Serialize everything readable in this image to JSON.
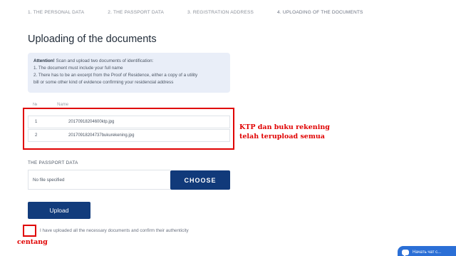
{
  "steps": [
    {
      "label": "1. THE PERSONAL DATA"
    },
    {
      "label": "2. THE PASSPORT DATA"
    },
    {
      "label": "3. REGISTRATION ADDRESS"
    },
    {
      "label": "4. UPLOADING OF THE DOCUMENTS"
    }
  ],
  "page_title": "Uploading of the documents",
  "info": {
    "attention_label": "Attention!",
    "line1": " Scan and upload two documents of identification:",
    "line2": "1. The document must include your full name",
    "line3": "2. There has to be an excerpt from the Proof of Residence, either a copy of a utility",
    "line4": "bill or some other kind of evidence confirming your residencial address"
  },
  "documents": {
    "col_num": "№",
    "col_name": "Name",
    "rows": [
      {
        "num": "1",
        "file": "20170918204600ktp.jpg"
      },
      {
        "num": "2",
        "file": "20170918204737bukurekening.jpg"
      }
    ]
  },
  "annotation_ktp": [
    "KTP dan buku rekening",
    "telah terupload semua"
  ],
  "passport": {
    "label": "THE PASSPORT DATA",
    "file_value": "No file specified",
    "choose_label": "CHOOSE"
  },
  "upload_label": "Upload",
  "confirm_text": "I have uploaded all the necessary documents and confirm their authenticity",
  "annotation_centang": "centang",
  "chat": {
    "label": "Начать чат с..."
  },
  "colors": {
    "accent": "#123c7c",
    "annotation": "#e00000",
    "info_bg": "#e9eef8"
  }
}
